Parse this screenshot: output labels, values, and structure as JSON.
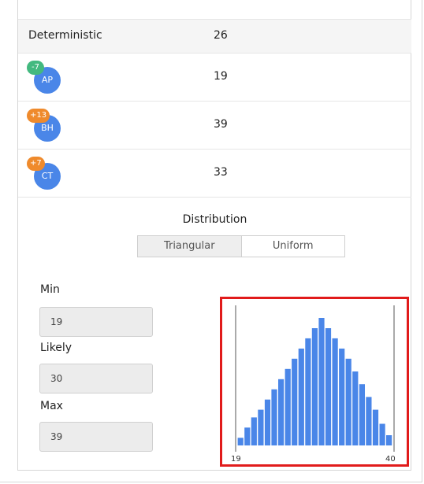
{
  "header_row": {
    "name": "Deterministic",
    "value": "26"
  },
  "estimates": [
    {
      "initials": "AP",
      "delta": "-7",
      "badge_color": "#43b97f",
      "value": "19"
    },
    {
      "initials": "BH",
      "delta": "+13",
      "badge_color": "#ef8a2c",
      "value": "39"
    },
    {
      "initials": "CT",
      "delta": "+7",
      "badge_color": "#ef8a2c",
      "value": "33"
    }
  ],
  "distribution": {
    "title": "Distribution",
    "options": [
      "Triangular",
      "Uniform"
    ],
    "selected": "Triangular"
  },
  "fields": {
    "min_label": "Min",
    "min_value": "19",
    "likely_label": "Likely",
    "likely_value": "30",
    "max_label": "Max",
    "max_value": "39"
  },
  "colors": {
    "bar": "#4a86e8",
    "highlight": "#e11b1b",
    "avatar": "#4a86e8"
  },
  "chart_data": {
    "type": "bar",
    "description_free": true,
    "x_min_label": "19",
    "x_max_label": "40",
    "values": [
      6,
      14,
      22,
      28,
      36,
      44,
      52,
      60,
      68,
      76,
      84,
      92,
      100,
      92,
      84,
      76,
      68,
      58,
      48,
      38,
      28,
      17,
      8
    ]
  }
}
